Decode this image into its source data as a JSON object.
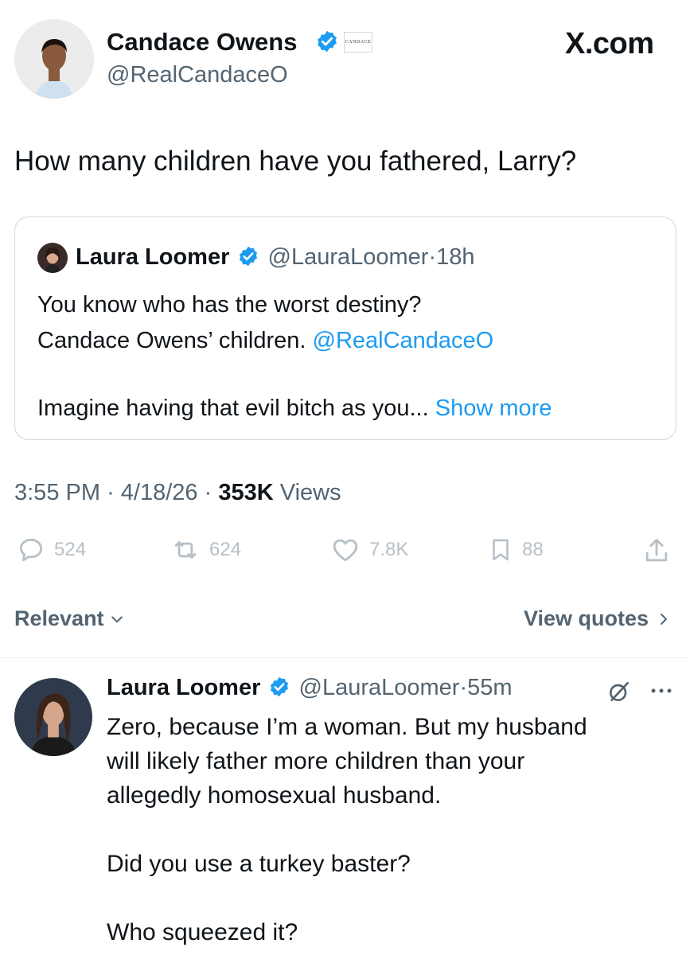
{
  "post": {
    "author_name": "Candace Owens",
    "author_handle": "@RealCandaceO",
    "brand_badge": "CANDACE",
    "site": "X.com",
    "text": "How many children have you fathered, Larry?",
    "timestamp": "3:55 PM",
    "date": "4/18/26",
    "views_count": "353K",
    "views_label": "Views",
    "separator": "·"
  },
  "quoted": {
    "author_name": "Laura Loomer",
    "author_handle": "@LauraLoomer",
    "time": "18h",
    "line1": "You know who has the worst destiny?",
    "line2": "Candace Owens’ children.",
    "mention": "@RealCandaceO",
    "line3": "Imagine having that evil bitch as you...",
    "show_more": "Show more"
  },
  "actions": {
    "replies": "524",
    "reposts": "624",
    "likes": "7.8K",
    "bookmarks": "88"
  },
  "sort": {
    "label": "Relevant",
    "view_quotes": "View quotes"
  },
  "reply": {
    "author_name": "Laura Loomer",
    "author_handle": "@LauraLoomer",
    "time": "55m",
    "line1": "Zero, because I’m a woman. But my husband",
    "line2": "will likely father more children than your",
    "line3": "allegedly homosexual husband.",
    "para2": "Did you use a turkey baster?",
    "para3": "Who squeezed it?"
  },
  "icons": {
    "verified": "verified-badge-icon",
    "reply": "reply-icon",
    "repost": "repost-icon",
    "like": "heart-icon",
    "bookmark": "bookmark-icon",
    "share": "share-icon",
    "grok": "grok-icon",
    "more": "more-icon"
  },
  "colors": {
    "verified": "#1d9bf0",
    "link": "#1d9bf0",
    "muted": "#536471"
  }
}
